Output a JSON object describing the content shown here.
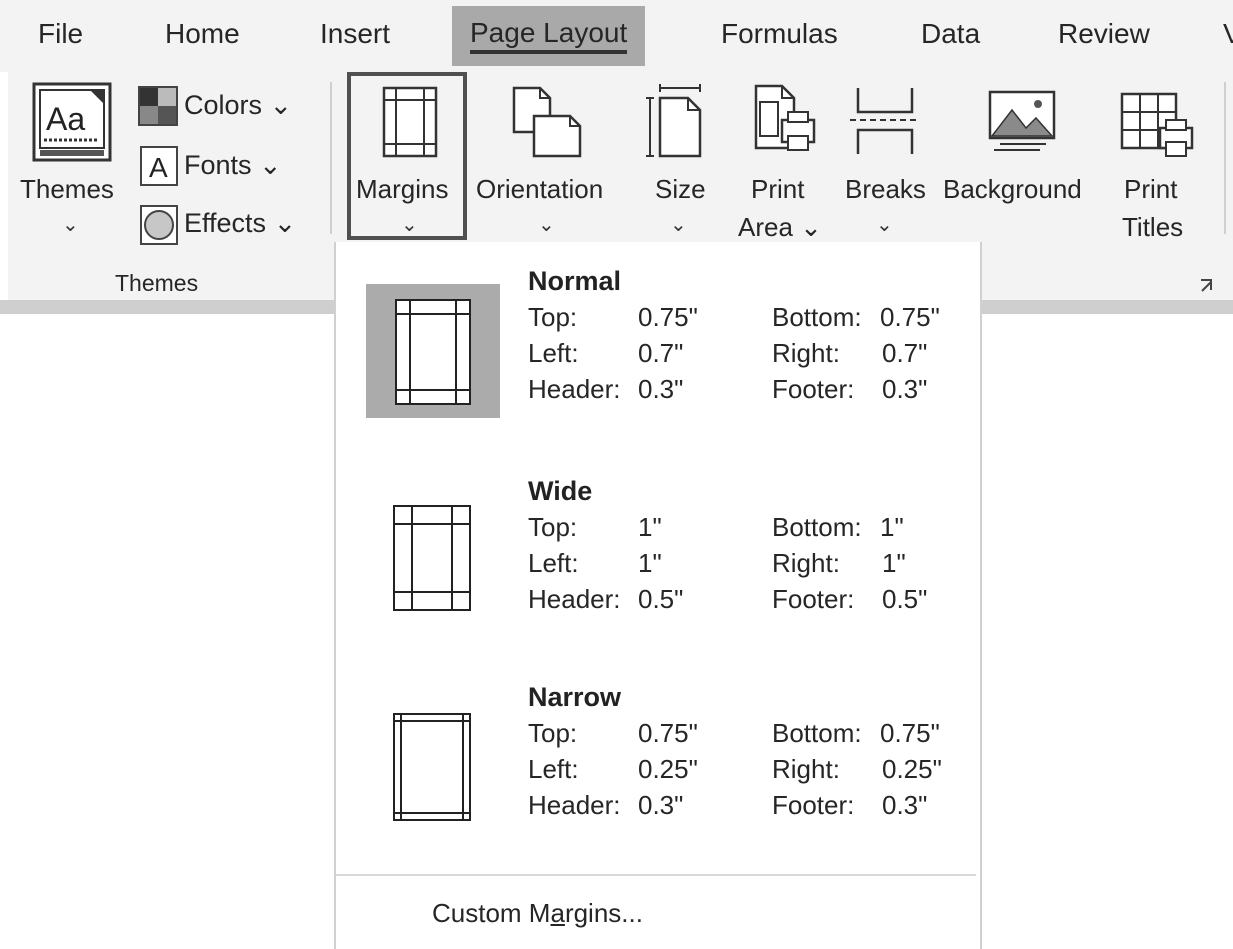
{
  "tabs": [
    "File",
    "Home",
    "Insert",
    "Page Layout",
    "Formulas",
    "Data",
    "Review",
    "V"
  ],
  "active_tab": "Page Layout",
  "ribbon": {
    "themes_label": "Themes",
    "colors_label": "Colors",
    "fonts_label": "Fonts",
    "effects_label": "Effects",
    "group_label": "Themes",
    "margins_label": "Margins",
    "orientation_label": "Orientation",
    "size_label": "Size",
    "print_area_line1": "Print",
    "print_area_line2": "Area",
    "breaks_label": "Breaks",
    "background_label": "Background",
    "print_titles_line1": "Print",
    "print_titles_line2": "Titles",
    "dropdown_chevron": "⌄"
  },
  "margins_menu": {
    "options": [
      {
        "name": "Normal",
        "top_label": "Top:",
        "top": "0.75\"",
        "bottom_label": "Bottom:",
        "bottom": "0.75\"",
        "left_label": "Left:",
        "left": "0.7\"",
        "right_label": "Right:",
        "right": "0.7\"",
        "header_label": "Header:",
        "header": "0.3\"",
        "footer_label": "Footer:",
        "footer": "0.3\""
      },
      {
        "name": "Wide",
        "top_label": "Top:",
        "top": "1\"",
        "bottom_label": "Bottom:",
        "bottom": "1\"",
        "left_label": "Left:",
        "left": "1\"",
        "right_label": "Right:",
        "right": "1\"",
        "header_label": "Header:",
        "header": "0.5\"",
        "footer_label": "Footer:",
        "footer": "0.5\""
      },
      {
        "name": "Narrow",
        "top_label": "Top:",
        "top": "0.75\"",
        "bottom_label": "Bottom:",
        "bottom": "0.75\"",
        "left_label": "Left:",
        "left": "0.25\"",
        "right_label": "Right:",
        "right": "0.25\"",
        "header_label": "Header:",
        "header": "0.3\"",
        "footer_label": "Footer:",
        "footer": "0.3\""
      }
    ],
    "custom_prefix": "Custom M",
    "custom_accel": "a",
    "custom_suffix": "rgins..."
  },
  "icons": [
    "themes-icon",
    "colors-icon",
    "fonts-icon",
    "effects-icon",
    "margins-icon",
    "orientation-icon",
    "size-icon",
    "print-area-icon",
    "breaks-icon",
    "background-icon",
    "print-titles-icon",
    "dialog-launcher-icon"
  ]
}
